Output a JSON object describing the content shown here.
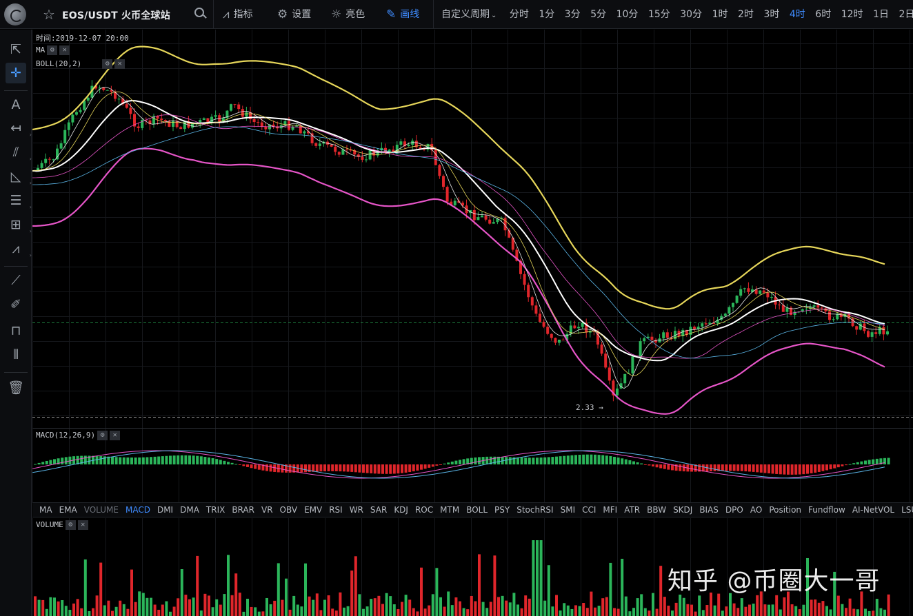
{
  "topbar": {
    "symbol": "EOS/USDT 火币全球站",
    "indicator_label": "指标",
    "settings_label": "设置",
    "theme_label": "亮色",
    "draw_label": "画线",
    "period_custom": "自定义周期",
    "periods": [
      "分时",
      "1分",
      "3分",
      "5分",
      "10分",
      "15分",
      "30分",
      "1时",
      "2时",
      "3时",
      "4时",
      "6时",
      "12时",
      "1日",
      "2日"
    ],
    "active_period": "4时"
  },
  "main_panel": {
    "time_label": "时间:2019-12-07 20:00",
    "ma_label": "MA",
    "boll_label": "BOLL(20,2)",
    "low_marker": "2.33 →"
  },
  "macd_panel": {
    "label": "MACD(12,26,9)"
  },
  "volume_panel": {
    "label": "VOLUME"
  },
  "indicator_tabs": [
    "MA",
    "EMA",
    "VOLUME",
    "MACD",
    "DMI",
    "DMA",
    "TRIX",
    "BRAR",
    "VR",
    "OBV",
    "EMV",
    "RSI",
    "WR",
    "SAR",
    "KDJ",
    "ROC",
    "MTM",
    "BOLL",
    "PSY",
    "StochRSI",
    "SMI",
    "CCI",
    "MFI",
    "ATR",
    "BBW",
    "SKDJ",
    "BIAS",
    "DPO",
    "AO",
    "Position",
    "Fundflow",
    "AI-NetVOL",
    "LSUR"
  ],
  "active_indicator": "MACD",
  "dim_indicator": "VOLUME",
  "watermark": "知乎 @币圈大一哥",
  "colors": {
    "up": "#2bb55a",
    "down": "#e0262b",
    "accent": "#3f8cff",
    "boll_upper": "#e6d65a",
    "boll_lower": "#e655c8"
  },
  "icons": [
    "star-icon",
    "search-icon",
    "indicator-icon",
    "gear-icon",
    "sun-icon",
    "pen-icon",
    "cursor-icon",
    "crosshair-icon",
    "text-icon",
    "line-icon",
    "channel-icon",
    "triangle-icon",
    "fib-icon",
    "rect-icon",
    "wave-icon",
    "ruler-icon",
    "brush-icon",
    "lock-icon",
    "candles-icon",
    "trash-icon"
  ]
}
